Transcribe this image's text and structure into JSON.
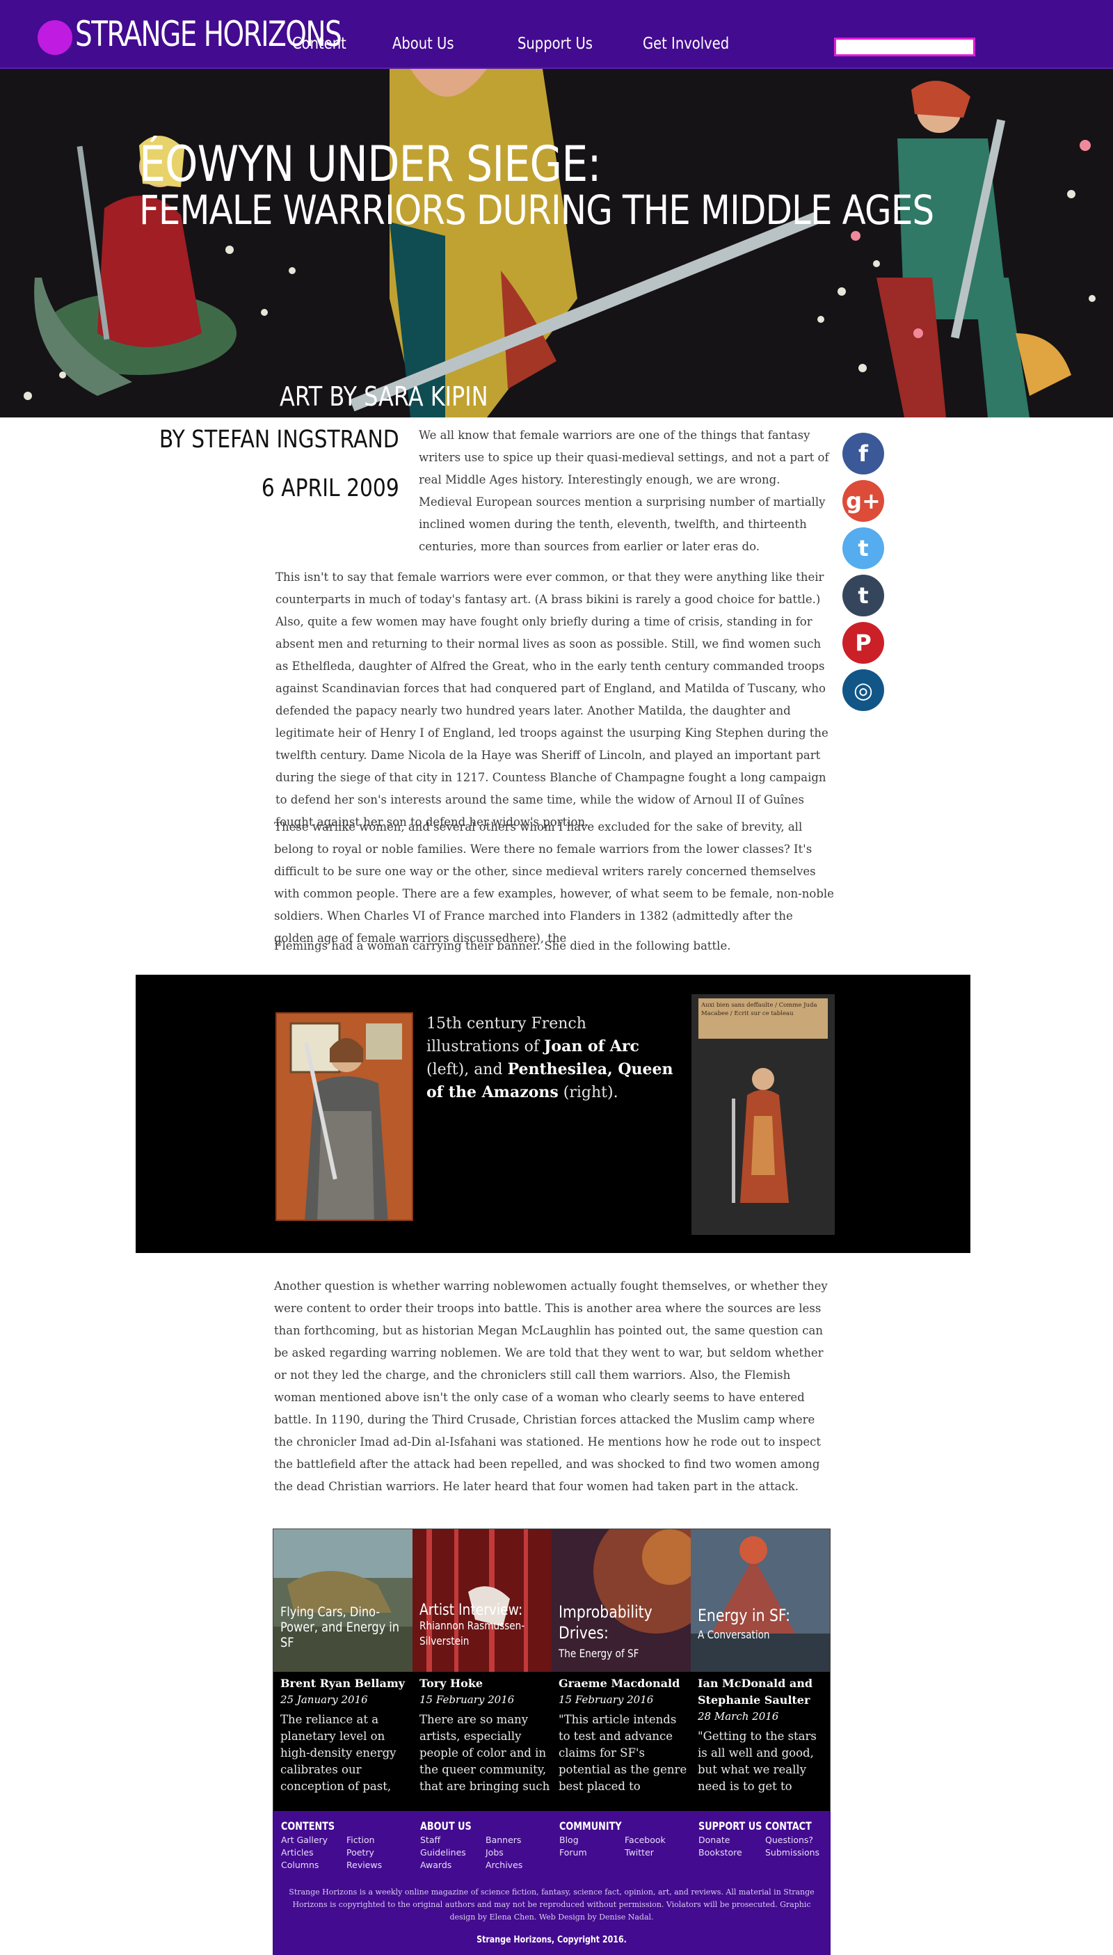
{
  "brand": {
    "name": "STRANGE HORIZONS",
    "primary_color": "#430b8f",
    "logo_color": "#c01be0"
  },
  "nav": {
    "items": [
      "Content",
      "About Us",
      "Support Us",
      "Get Involved"
    ],
    "search_value": ""
  },
  "hero": {
    "title_line1": "ÉOWYN UNDER SIEGE:",
    "title_line2": "FEMALE WARRIORS DURING THE MIDDLE AGES",
    "art_credit": "ART BY SARA KIPIN"
  },
  "article": {
    "byline": "BY STEFAN INGSTRAND",
    "date": "6 APRIL 2009",
    "p_intro": "We all know that female warriors are one of the things that fantasy writers use to spice up their quasi-medieval settings, and not a part of real Middle Ages history. Interestingly enough, we are wrong. Medieval European sources mention a surprising number of martially inclined women during the tenth, eleventh, twelfth, and thirteenth centuries, more than sources from earlier or later eras do.",
    "p_two": "This isn't to say that female warriors were ever common, or that they were anything like their counterparts in much of today's fantasy art. (A brass bikini is rarely a good choice for battle.) Also, quite a few women may have fought only briefly during a time of crisis, standing in for absent men and returning to their normal lives as soon as possible. Still, we find women such as Ethelfleda, daughter of Alfred the Great, who in the early tenth century commanded troops against Scandinavian forces that had conquered part of England, and Matilda of Tuscany, who defended the papacy nearly two hundred years later. Another Matilda, the daughter and legitimate heir of Henry I of England, led troops against the usurping King Stephen during the twelfth century. Dame Nicola de la Haye was Sheriff of Lincoln, and played an important part during the siege of that city in 1217. Countess Blanche of Champagne fought a long campaign to defend her son's interests around the same time, while the widow of Arnoul II of Guînes fought against her son to defend her widow's portion.",
    "p_three": "These warlike women, and several others whom I have excluded for the sake of brevity, all belong to royal or noble families. Were there no female warriors from the lower classes? It's difficult to be sure one way or the other, since medieval writers rarely concerned themselves with common people. There are a few examples, however, of what seem to be female, non-noble soldiers. When Charles VI of France marched into Flanders in 1382 (admittedly after the golden age of female warriors discussedhere), the",
    "p_three_b": "Flemings had a woman carrying their banner. She died in the following battle.",
    "p_four": "Another question is whether warring noblewomen actually fought themselves, or whether they were content to order their troops into battle. This is another area where the sources are less than forthcoming, but as historian Megan McLaughlin has pointed out, the same question can be asked regarding warring noblemen. We are told that they went to war, but seldom whether or not they led the charge, and the chroniclers still call them warriors. Also, the Flemish woman mentioned above isn't the only case of a woman who clearly seems to have entered battle. In 1190, during the Third Crusade, Christian forces attacked the Muslim camp where the chronicler Imad ad-Din al-Isfahani was stationed. He mentions how he rode out to inspect the battlefield after the attack had been repelled, and was shocked to find two women among the dead Christian warriors. He later heard that four women had taken part in the attack."
  },
  "social": [
    "facebook-icon",
    "google-plus-icon",
    "twitter-icon",
    "tumblr-icon",
    "pinterest-icon",
    "instagram-icon"
  ],
  "social_glyphs": [
    "f",
    "g+",
    "t",
    "t",
    "P",
    "◎"
  ],
  "social_colors": [
    "#3b5998",
    "#dd4b39",
    "#55acee",
    "#35465c",
    "#cb2027",
    "#125688"
  ],
  "figure": {
    "caption_pre": "15th century French illustrations of ",
    "caption_name1": "Joan of Arc",
    "caption_mid": " (left), and ",
    "caption_name2": "Penthesilea, Queen of the Amazons",
    "caption_post": " (right).",
    "banner_text": "Auxi bien sans deffaulte / Comme Juda Macabee / Ecrit sur ce tableau"
  },
  "related": [
    {
      "title": "Flying Cars, Dino-Power, and Energy in SF",
      "subtitle": "",
      "author": "Brent Ryan Bellamy",
      "date": "25 January 2016",
      "excerpt": "The reliance at a planetary level on high-density energy calibrates our conception of past, present,"
    },
    {
      "title": "Artist Interview:",
      "subtitle": "Rhiannon Rasmussen-Silverstein",
      "author": "Tory Hoke",
      "date": "15 February 2016",
      "excerpt": "There are so many artists, especially people of color and in the queer community, that are bringing such"
    },
    {
      "title": "Improbability Drives:",
      "subtitle": "The Energy of SF",
      "author": "Graeme Macdonald",
      "date": "15 February 2016",
      "excerpt": "\"This article intends to test and advance claims for SF's potential as the genre best placed to advance our"
    },
    {
      "title": "Energy in SF:",
      "subtitle": "A Conversation",
      "author": "Ian McDonald and Stephanie Saulter",
      "date": "28 March 2016",
      "excerpt": "\"Getting to the stars is all well and good, but what we really need is to get to work.\""
    }
  ],
  "footer": {
    "contents_head": "CONTENTS",
    "contents_links": [
      "Art Gallery",
      "Articles",
      "Columns",
      "Fiction",
      "Poetry",
      "Reviews"
    ],
    "about_head": "ABOUT US",
    "about_links": [
      "Staff",
      "Guidelines",
      "Awards",
      "Banners",
      "Jobs",
      "Archives"
    ],
    "community_head": "COMMUNITY",
    "community_links": [
      "Blog",
      "Forum",
      "Facebook",
      "Twitter"
    ],
    "support_head": "SUPPORT US",
    "support_links": [
      "Donate",
      "Bookstore"
    ],
    "contact_head": "CONTACT",
    "contact_links": [
      "Questions?",
      "Submissions"
    ],
    "legal": "Strange Horizons is a weekly online magazine of science fiction, fantasy, science fact, opinion, art, and reviews. All material in Strange Horizons is copyrighted to the original authors and may not be reproduced without permission. Violators will be prosecuted. Graphic design by Elena Chen. Web Design by Denise Nadal.",
    "copyright": "Strange Horizons, Copyright 2016."
  }
}
